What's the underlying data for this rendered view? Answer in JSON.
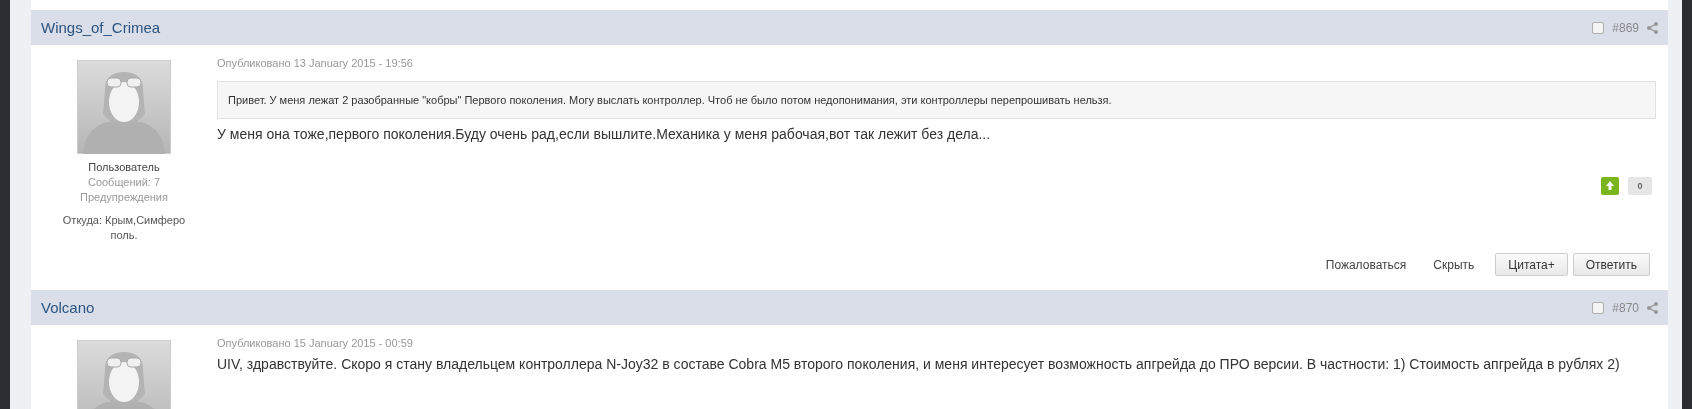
{
  "posts": [
    {
      "author": "Wings_of_Crimea",
      "selected": false,
      "number": "#869",
      "date": "Опубликовано 13 January 2015 - 19:56",
      "group": "Пользователь",
      "messages": "Сообщений: 7",
      "warnings": "Предупреждения",
      "location": "Откуда: Крым,Симферополь.",
      "quote": "Привет. У меня лежат 2 разобранные \"кобры\" Первого поколения. Могу выслать контроллер. Чтоб не было потом недопонимания, эти контроллеры перепрошивать нельзя.",
      "body": "У меня она тоже,первого поколения.Буду очень рад,если вышлите.Механика у меня рабочая,вот так лежит без дела...",
      "reputation": "0",
      "actions": [
        {
          "label": "Пожаловаться",
          "kind": "link"
        },
        {
          "label": "Скрыть",
          "kind": "link"
        },
        {
          "label": "Цитата+",
          "kind": "button"
        },
        {
          "label": "Ответить",
          "kind": "button"
        }
      ]
    },
    {
      "author": "Volcano",
      "selected": false,
      "number": "#870",
      "date": "Опубликовано 15 January 2015 - 00:59",
      "body": "UIV, здравствуйте. Скоро я стану владельцем контроллера N-Joy32 в составе Cobra M5 второго поколения, и меня интересует возможность апгрейда до ПРО версии. В частности: 1) Стоимость апгрейда в рублях 2)"
    }
  ]
}
